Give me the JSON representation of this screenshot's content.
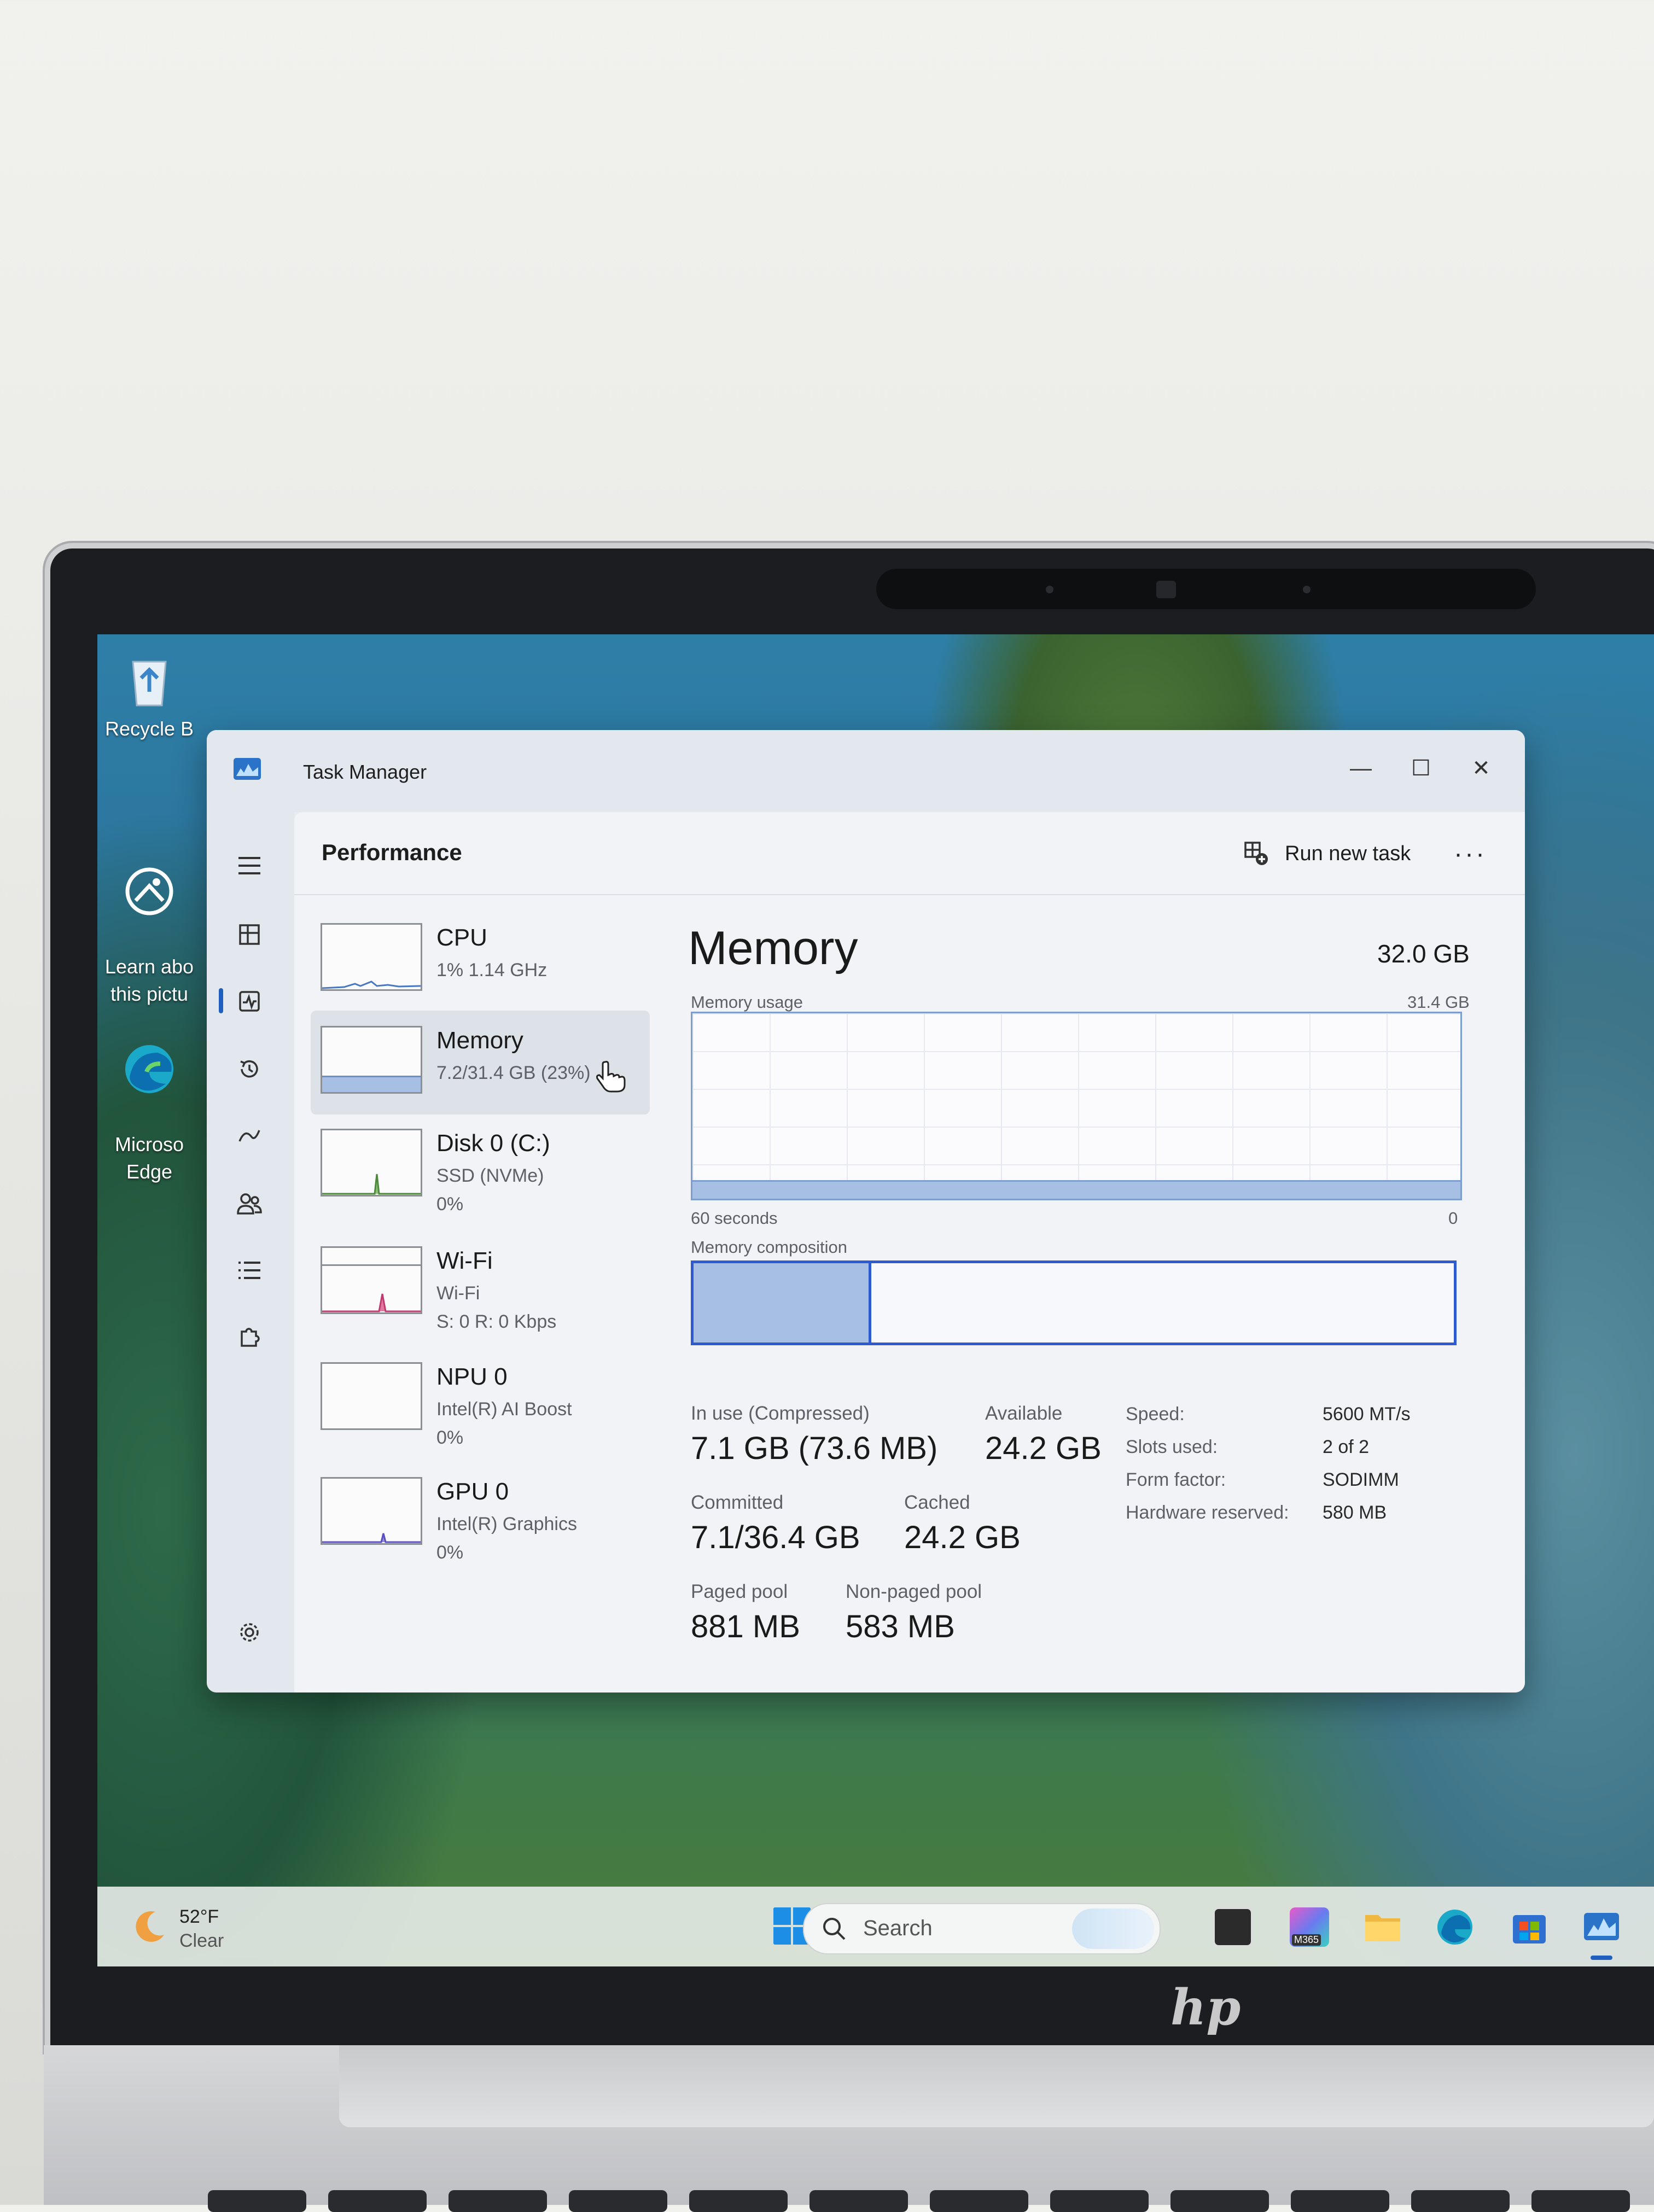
{
  "desktop": {
    "icons": [
      {
        "label": "Recycle B",
        "icon": "recycle-bin-icon"
      },
      {
        "label": "Learn abo\nthis pictu",
        "icon": "camera-icon"
      },
      {
        "label": "Microso\nEdge",
        "icon": "edge-icon"
      }
    ]
  },
  "window": {
    "title": "Task Manager",
    "controls": {
      "minimize": "—",
      "maximize": "☐",
      "close": "✕"
    }
  },
  "header": {
    "title": "Performance",
    "run_new_task": "Run new task",
    "more": "···"
  },
  "devices": [
    {
      "name": "CPU",
      "sub1": "1%  1.14 GHz",
      "sub2": ""
    },
    {
      "name": "Memory",
      "sub1": "7.2/31.4 GB (23%)",
      "sub2": ""
    },
    {
      "name": "Disk 0 (C:)",
      "sub1": "SSD (NVMe)",
      "sub2": "0%"
    },
    {
      "name": "Wi-Fi",
      "sub1": "Wi-Fi",
      "sub2": "S: 0  R: 0 Kbps"
    },
    {
      "name": "NPU 0",
      "sub1": "Intel(R) AI Boost",
      "sub2": "0%"
    },
    {
      "name": "GPU 0",
      "sub1": "Intel(R) Graphics",
      "sub2": "0%"
    }
  ],
  "memory": {
    "title": "Memory",
    "total": "32.0 GB",
    "usage_label": "Memory usage",
    "usage_max": "31.4 GB",
    "usage_fraction": 0.23,
    "time_left": "60 seconds",
    "time_right": "0",
    "composition_label": "Memory composition",
    "composition_in_use_fraction": 0.23,
    "stats": {
      "in_use_label": "In use (Compressed)",
      "in_use_value": "7.1 GB (73.6 MB)",
      "available_label": "Available",
      "available_value": "24.2 GB",
      "committed_label": "Committed",
      "committed_value": "7.1/36.4 GB",
      "cached_label": "Cached",
      "cached_value": "24.2 GB",
      "paged_label": "Paged pool",
      "paged_value": "881 MB",
      "nonpaged_label": "Non-paged pool",
      "nonpaged_value": "583 MB"
    },
    "specs": [
      {
        "label": "Speed:",
        "value": "5600 MT/s"
      },
      {
        "label": "Slots used:",
        "value": "2 of 2"
      },
      {
        "label": "Form factor:",
        "value": "SODIMM"
      },
      {
        "label": "Hardware reserved:",
        "value": "580 MB"
      }
    ]
  },
  "taskbar": {
    "weather_temp": "52°F",
    "weather_cond": "Clear",
    "search_placeholder": "Search",
    "copilot_badge": "M365"
  },
  "colors": {
    "accent": "#2f5bd0",
    "memory_fill": "#a6bfe3",
    "memory_border": "#7e9fce"
  }
}
